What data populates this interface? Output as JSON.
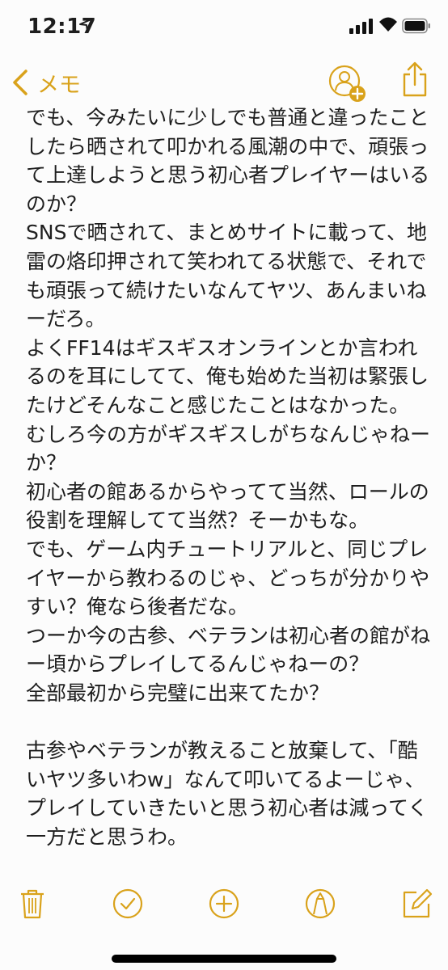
{
  "status": {
    "time": "12:17",
    "icons": [
      "location-arrow-icon",
      "cellular-signal-icon",
      "wifi-icon",
      "battery-icon"
    ]
  },
  "nav": {
    "back_label": "メモ",
    "icons": [
      "chevron-left-icon",
      "add-person-icon",
      "share-icon"
    ]
  },
  "note": {
    "paragraphs": [
      "でも、今みたいに少しでも普通と違ったことしたら晒されて叩かれる風潮の中で、頑張って上達しようと思う初心者プレイヤーはいるのか？",
      "SNSで晒されて、まとめサイトに載って、地雷の烙印押されて笑われてる状態で、それでも頑張って続けたいなんてヤツ、あんまいねーだろ。",
      "よくFF14はギスギスオンラインとか言われるのを耳にしてて、俺も始めた当初は緊張したけどそんなこと感じたことはなかった。",
      "むしろ今の方がギスギスしがちなんじゃねーか？",
      "初心者の館あるからやってて当然、ロールの役割を理解してて当然？そーかもな。",
      "でも、ゲーム内チュートリアルと、同じプレイヤーから教わるのじゃ、どっちが分かりやすい？俺なら後者だな。",
      "つーか今の古参、ベテランは初心者の館がねー頃からプレイしてるんじゃねーの？",
      "全部最初から完璧に出来てたか？",
      "",
      "古参やベテランが教えること放棄して、「酷いヤツ多いわw」なんて叩いてるよーじゃ、プレイしていきたいと思う初心者は減ってく一方だと思うわ。"
    ]
  },
  "toolbar": {
    "icons": [
      "trash-icon",
      "checklist-icon",
      "add-icon",
      "markup-icon",
      "compose-icon"
    ]
  },
  "colors": {
    "accent": "#d9a21b",
    "text": "#1e1e1e",
    "background": "#fcfcfc"
  }
}
